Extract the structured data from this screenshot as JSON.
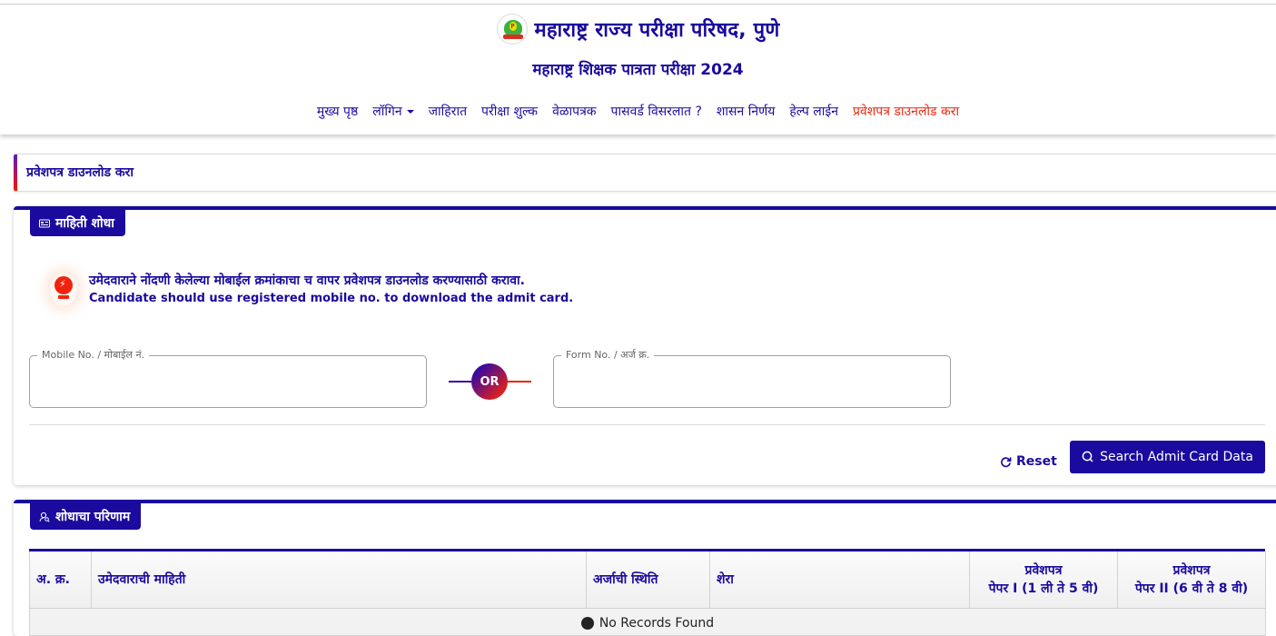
{
  "header": {
    "org_title": "महाराष्ट्र राज्य परीक्षा परिषद, पुणे",
    "sub_title": "महाराष्ट्र शिक्षक पात्रता परीक्षा 2024",
    "logo_icon": "mscepune-logo-icon"
  },
  "nav": {
    "items": [
      {
        "label": "मुख्य पृष्ठ"
      },
      {
        "label": "लॉगिन",
        "dropdown": true
      },
      {
        "label": "जाहिरात"
      },
      {
        "label": "परीक्षा शुल्क"
      },
      {
        "label": "वेळापत्रक"
      },
      {
        "label": "पासवर्ड विसरलात ?"
      },
      {
        "label": "शासन निर्णय"
      },
      {
        "label": "हेल्प लाईन"
      },
      {
        "label": "प्रवेशपत्र डाउनलोड करा",
        "active": true
      }
    ]
  },
  "page_heading": "प्रवेशपत्र डाउनलोड करा",
  "search_card": {
    "tab_label": "माहिती शोधा",
    "tab_icon": "id-card-icon",
    "info_marathi": "उमेदवाराने नोंदणी केलेल्या मोबाईल क्रमांकाचा च वापर प्रवेशपत्र डाउनलोड करण्यासाठी करावा.",
    "info_english": "Candidate should use registered mobile no. to download the admit card.",
    "info_icon": "lightbulb-icon",
    "mobile_label": "Mobile No. / मोबाईल नं.",
    "mobile_value": "",
    "or_label": "OR",
    "form_label": "Form No. / अर्ज क्र.",
    "form_value": "",
    "reset_label": "Reset",
    "search_label": "Search Admit Card Data"
  },
  "result_card": {
    "tab_label": "शोधाचा परिणाम",
    "tab_icon": "user-search-icon",
    "columns": [
      {
        "label": "अ. क्र."
      },
      {
        "label": "उमेदवाराची माहिती"
      },
      {
        "label": "अर्जाची स्थिति"
      },
      {
        "label": "शेरा"
      },
      {
        "line1": "प्रवेशपत्र",
        "line2": "पेपर I (1 ली ते 5 वी)"
      },
      {
        "line1": "प्रवेशपत्र",
        "line2": "पेपर II (6 वी ते 8 वी)"
      }
    ],
    "empty_message": "No Records Found"
  },
  "colors": {
    "primary": "#1a0a9e",
    "accent": "#e8280e"
  }
}
